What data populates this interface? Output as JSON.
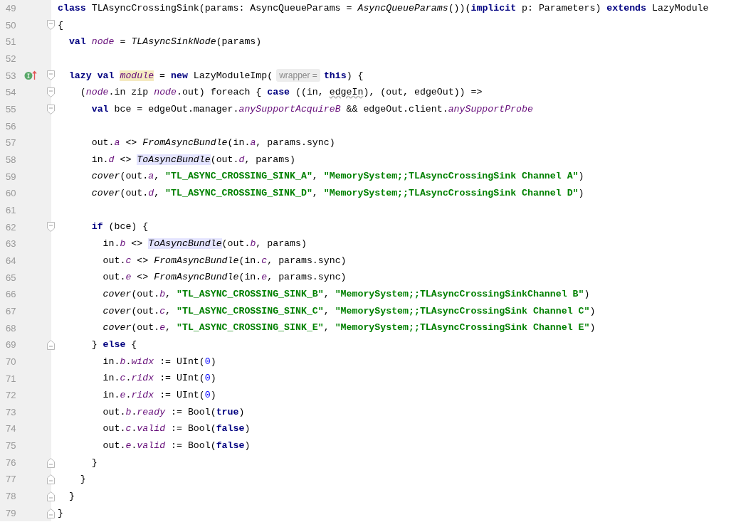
{
  "editor": {
    "lines": [
      {
        "number": "49",
        "tokens": [
          {
            "kind": "keyword",
            "text": "class"
          },
          {
            "kind": "plain",
            "text": " TLAsyncCrossingSink(params: AsyncQueueParams = "
          },
          {
            "kind": "italic",
            "text": "AsyncQueueParams"
          },
          {
            "kind": "plain",
            "text": "())("
          },
          {
            "kind": "keyword",
            "text": "implicit"
          },
          {
            "kind": "plain",
            "text": " p: Parameters) "
          },
          {
            "kind": "keyword",
            "text": "extends"
          },
          {
            "kind": "plain",
            "text": " LazyModule"
          }
        ]
      },
      {
        "number": "50",
        "fold_open": true,
        "tokens": [
          {
            "kind": "plain",
            "text": "{"
          }
        ],
        "children": [
          {
            "number": "51",
            "tokens": [
              {
                "kind": "keyword",
                "text": "val "
              },
              {
                "kind": "field",
                "text": "node"
              },
              {
                "kind": "plain",
                "text": " = "
              },
              {
                "kind": "italic",
                "text": "TLAsyncSinkNode"
              },
              {
                "kind": "plain",
                "text": "(params)"
              }
            ]
          },
          {
            "number": "52"
          },
          {
            "number": "53",
            "fold_open": true,
            "marker": true,
            "tokens": [
              {
                "kind": "keyword",
                "text": "lazy val "
              },
              {
                "kind": "symbol",
                "text": "module"
              },
              {
                "kind": "plain",
                "text": " = "
              },
              {
                "kind": "keyword",
                "text": "new"
              },
              {
                "kind": "plain",
                "text": " LazyModuleImp("
              },
              {
                "kind": "hint",
                "text": "wrapper ="
              },
              {
                "kind": "keyword",
                "text": "this"
              },
              {
                "kind": "plain",
                "text": ") {"
              }
            ],
            "children": [
              {
                "number": "54",
                "fold_open": true,
                "tokens": [
                  {
                    "kind": "plain",
                    "text": "("
                  },
                  {
                    "kind": "field",
                    "text": "node"
                  },
                  {
                    "kind": "plain",
                    "text": ".in zip "
                  },
                  {
                    "kind": "field",
                    "text": "node"
                  },
                  {
                    "kind": "plain",
                    "text": ".out) foreach { "
                  },
                  {
                    "kind": "keyword",
                    "text": "case"
                  },
                  {
                    "kind": "plain",
                    "text": " ((in, "
                  },
                  {
                    "kind": "warning",
                    "text": "edgeIn"
                  },
                  {
                    "kind": "plain",
                    "text": "), (out, edgeOut)) =>"
                  }
                ],
                "children": [
                  {
                    "number": "55",
                    "fold_open": true,
                    "tokens": [
                      {
                        "kind": "keyword",
                        "text": "val"
                      },
                      {
                        "kind": "plain",
                        "text": " bce = edgeOut.manager."
                      },
                      {
                        "kind": "field",
                        "text": "anySupportAcquireB"
                      },
                      {
                        "kind": "plain",
                        "text": " && edgeOut.client."
                      },
                      {
                        "kind": "field",
                        "text": "anySupportProbe"
                      }
                    ]
                  },
                  {
                    "number": "56"
                  },
                  {
                    "number": "57",
                    "tokens": [
                      {
                        "kind": "plain",
                        "text": "out."
                      },
                      {
                        "kind": "field",
                        "text": "a"
                      },
                      {
                        "kind": "plain",
                        "text": " <> "
                      },
                      {
                        "kind": "italic",
                        "text": "FromAsyncBundle"
                      },
                      {
                        "kind": "plain",
                        "text": "(in."
                      },
                      {
                        "kind": "field",
                        "text": "a"
                      },
                      {
                        "kind": "plain",
                        "text": ", params.sync)"
                      }
                    ]
                  },
                  {
                    "number": "58",
                    "tokens": [
                      {
                        "kind": "plain",
                        "text": "in."
                      },
                      {
                        "kind": "field",
                        "text": "d"
                      },
                      {
                        "kind": "plain",
                        "text": " <> "
                      },
                      {
                        "kind": "usage",
                        "text": "ToAsyncBundle"
                      },
                      {
                        "kind": "plain",
                        "text": "(out."
                      },
                      {
                        "kind": "field",
                        "text": "d"
                      },
                      {
                        "kind": "plain",
                        "text": ", params)"
                      }
                    ]
                  },
                  {
                    "number": "59",
                    "tokens": [
                      {
                        "kind": "italic",
                        "text": "cover"
                      },
                      {
                        "kind": "plain",
                        "text": "(out."
                      },
                      {
                        "kind": "field",
                        "text": "a"
                      },
                      {
                        "kind": "plain",
                        "text": ", "
                      },
                      {
                        "kind": "string",
                        "text": "\"TL_ASYNC_CROSSING_SINK_A\""
                      },
                      {
                        "kind": "plain",
                        "text": ", "
                      },
                      {
                        "kind": "string",
                        "text": "\"MemorySystem;;TLAsyncCrossingSink Channel A\""
                      },
                      {
                        "kind": "plain",
                        "text": ")"
                      }
                    ]
                  },
                  {
                    "number": "60",
                    "tokens": [
                      {
                        "kind": "italic",
                        "text": "cover"
                      },
                      {
                        "kind": "plain",
                        "text": "(out."
                      },
                      {
                        "kind": "field",
                        "text": "d"
                      },
                      {
                        "kind": "plain",
                        "text": ", "
                      },
                      {
                        "kind": "string",
                        "text": "\"TL_ASYNC_CROSSING_SINK_D\""
                      },
                      {
                        "kind": "plain",
                        "text": ", "
                      },
                      {
                        "kind": "string",
                        "text": "\"MemorySystem;;TLAsyncCrossingSink Channel D\""
                      },
                      {
                        "kind": "plain",
                        "text": ")"
                      }
                    ]
                  },
                  {
                    "number": "61"
                  },
                  {
                    "number": "62",
                    "fold_open": true,
                    "tokens": [
                      {
                        "kind": "keyword",
                        "text": "if"
                      },
                      {
                        "kind": "plain",
                        "text": " (bce) {"
                      }
                    ],
                    "children": [
                      {
                        "number": "63",
                        "tokens": [
                          {
                            "kind": "plain",
                            "text": "in."
                          },
                          {
                            "kind": "field",
                            "text": "b"
                          },
                          {
                            "kind": "plain",
                            "text": " <> "
                          },
                          {
                            "kind": "usage",
                            "text": "ToAsyncBundle"
                          },
                          {
                            "kind": "plain",
                            "text": "(out."
                          },
                          {
                            "kind": "field",
                            "text": "b"
                          },
                          {
                            "kind": "plain",
                            "text": ", params)"
                          }
                        ]
                      },
                      {
                        "number": "64",
                        "tokens": [
                          {
                            "kind": "plain",
                            "text": "out."
                          },
                          {
                            "kind": "field",
                            "text": "c"
                          },
                          {
                            "kind": "plain",
                            "text": " <> "
                          },
                          {
                            "kind": "italic",
                            "text": "FromAsyncBundle"
                          },
                          {
                            "kind": "plain",
                            "text": "(in."
                          },
                          {
                            "kind": "field",
                            "text": "c"
                          },
                          {
                            "kind": "plain",
                            "text": ", params.sync)"
                          }
                        ]
                      },
                      {
                        "number": "65",
                        "tokens": [
                          {
                            "kind": "plain",
                            "text": "out."
                          },
                          {
                            "kind": "field",
                            "text": "e"
                          },
                          {
                            "kind": "plain",
                            "text": " <> "
                          },
                          {
                            "kind": "italic",
                            "text": "FromAsyncBundle"
                          },
                          {
                            "kind": "plain",
                            "text": "(in."
                          },
                          {
                            "kind": "field",
                            "text": "e"
                          },
                          {
                            "kind": "plain",
                            "text": ", params.sync)"
                          }
                        ]
                      },
                      {
                        "number": "66",
                        "tokens": [
                          {
                            "kind": "italic",
                            "text": "cover"
                          },
                          {
                            "kind": "plain",
                            "text": "(out."
                          },
                          {
                            "kind": "field",
                            "text": "b"
                          },
                          {
                            "kind": "plain",
                            "text": ", "
                          },
                          {
                            "kind": "string",
                            "text": "\"TL_ASYNC_CROSSING_SINK_B\""
                          },
                          {
                            "kind": "plain",
                            "text": ", "
                          },
                          {
                            "kind": "string",
                            "text": "\"MemorySystem;;TLAsyncCrossingSinkChannel B\""
                          },
                          {
                            "kind": "plain",
                            "text": ")"
                          }
                        ]
                      },
                      {
                        "number": "67",
                        "tokens": [
                          {
                            "kind": "italic",
                            "text": "cover"
                          },
                          {
                            "kind": "plain",
                            "text": "(out."
                          },
                          {
                            "kind": "field",
                            "text": "c"
                          },
                          {
                            "kind": "plain",
                            "text": ", "
                          },
                          {
                            "kind": "string",
                            "text": "\"TL_ASYNC_CROSSING_SINK_C\""
                          },
                          {
                            "kind": "plain",
                            "text": ", "
                          },
                          {
                            "kind": "string",
                            "text": "\"MemorySystem;;TLAsyncCrossingSink Channel C\""
                          },
                          {
                            "kind": "plain",
                            "text": ")"
                          }
                        ]
                      },
                      {
                        "number": "68",
                        "tokens": [
                          {
                            "kind": "italic",
                            "text": "cover"
                          },
                          {
                            "kind": "plain",
                            "text": "(out."
                          },
                          {
                            "kind": "field",
                            "text": "e"
                          },
                          {
                            "kind": "plain",
                            "text": ", "
                          },
                          {
                            "kind": "string",
                            "text": "\"TL_ASYNC_CROSSING_SINK_E\""
                          },
                          {
                            "kind": "plain",
                            "text": ", "
                          },
                          {
                            "kind": "string",
                            "text": "\"MemorySystem;;TLAsyncCrossingSink Channel E\""
                          },
                          {
                            "kind": "plain",
                            "text": ")"
                          }
                        ]
                      }
                    ]
                  },
                  {
                    "number": "69",
                    "fold_close": true,
                    "tokens": [
                      {
                        "kind": "plain",
                        "text": "} "
                      },
                      {
                        "kind": "keyword",
                        "text": "else"
                      },
                      {
                        "kind": "plain",
                        "text": " {"
                      }
                    ],
                    "children": [
                      {
                        "number": "70",
                        "tokens": [
                          {
                            "kind": "plain",
                            "text": "in."
                          },
                          {
                            "kind": "field",
                            "text": "b"
                          },
                          {
                            "kind": "plain",
                            "text": "."
                          },
                          {
                            "kind": "field",
                            "text": "widx"
                          },
                          {
                            "kind": "plain",
                            "text": " := UInt("
                          },
                          {
                            "kind": "number",
                            "text": "0"
                          },
                          {
                            "kind": "plain",
                            "text": ")"
                          }
                        ]
                      },
                      {
                        "number": "71",
                        "tokens": [
                          {
                            "kind": "plain",
                            "text": "in."
                          },
                          {
                            "kind": "field",
                            "text": "c"
                          },
                          {
                            "kind": "plain",
                            "text": "."
                          },
                          {
                            "kind": "field",
                            "text": "ridx"
                          },
                          {
                            "kind": "plain",
                            "text": " := UInt("
                          },
                          {
                            "kind": "number",
                            "text": "0"
                          },
                          {
                            "kind": "plain",
                            "text": ")"
                          }
                        ]
                      },
                      {
                        "number": "72",
                        "tokens": [
                          {
                            "kind": "plain",
                            "text": "in."
                          },
                          {
                            "kind": "field",
                            "text": "e"
                          },
                          {
                            "kind": "plain",
                            "text": "."
                          },
                          {
                            "kind": "field",
                            "text": "ridx"
                          },
                          {
                            "kind": "plain",
                            "text": " := UInt("
                          },
                          {
                            "kind": "number",
                            "text": "0"
                          },
                          {
                            "kind": "plain",
                            "text": ")"
                          }
                        ]
                      },
                      {
                        "number": "73",
                        "tokens": [
                          {
                            "kind": "plain",
                            "text": "out."
                          },
                          {
                            "kind": "field",
                            "text": "b"
                          },
                          {
                            "kind": "plain",
                            "text": "."
                          },
                          {
                            "kind": "field",
                            "text": "ready"
                          },
                          {
                            "kind": "plain",
                            "text": " := Bool("
                          },
                          {
                            "kind": "keyword",
                            "text": "true"
                          },
                          {
                            "kind": "plain",
                            "text": ")"
                          }
                        ]
                      },
                      {
                        "number": "74",
                        "tokens": [
                          {
                            "kind": "plain",
                            "text": "out."
                          },
                          {
                            "kind": "field",
                            "text": "c"
                          },
                          {
                            "kind": "plain",
                            "text": "."
                          },
                          {
                            "kind": "field",
                            "text": "valid"
                          },
                          {
                            "kind": "plain",
                            "text": " := Bool("
                          },
                          {
                            "kind": "keyword",
                            "text": "false"
                          },
                          {
                            "kind": "plain",
                            "text": ")"
                          }
                        ]
                      },
                      {
                        "number": "75",
                        "tokens": [
                          {
                            "kind": "plain",
                            "text": "out."
                          },
                          {
                            "kind": "field",
                            "text": "e"
                          },
                          {
                            "kind": "plain",
                            "text": "."
                          },
                          {
                            "kind": "field",
                            "text": "valid"
                          },
                          {
                            "kind": "plain",
                            "text": " := Bool("
                          },
                          {
                            "kind": "keyword",
                            "text": "false"
                          },
                          {
                            "kind": "plain",
                            "text": ")"
                          }
                        ]
                      }
                    ]
                  },
                  {
                    "number": "76",
                    "fold_close": true,
                    "tokens": [
                      {
                        "kind": "plain",
                        "text": "}"
                      }
                    ]
                  }
                ]
              },
              {
                "number": "77",
                "fold_close": true,
                "tokens": [
                  {
                    "kind": "plain",
                    "text": "}"
                  }
                ]
              }
            ]
          },
          {
            "number": "78",
            "fold_close": true,
            "tokens": [
              {
                "kind": "plain",
                "text": "}"
              }
            ]
          }
        ]
      },
      {
        "number": "79",
        "fold_close": true,
        "tokens": [
          {
            "kind": "plain",
            "text": "}"
          }
        ]
      }
    ]
  }
}
